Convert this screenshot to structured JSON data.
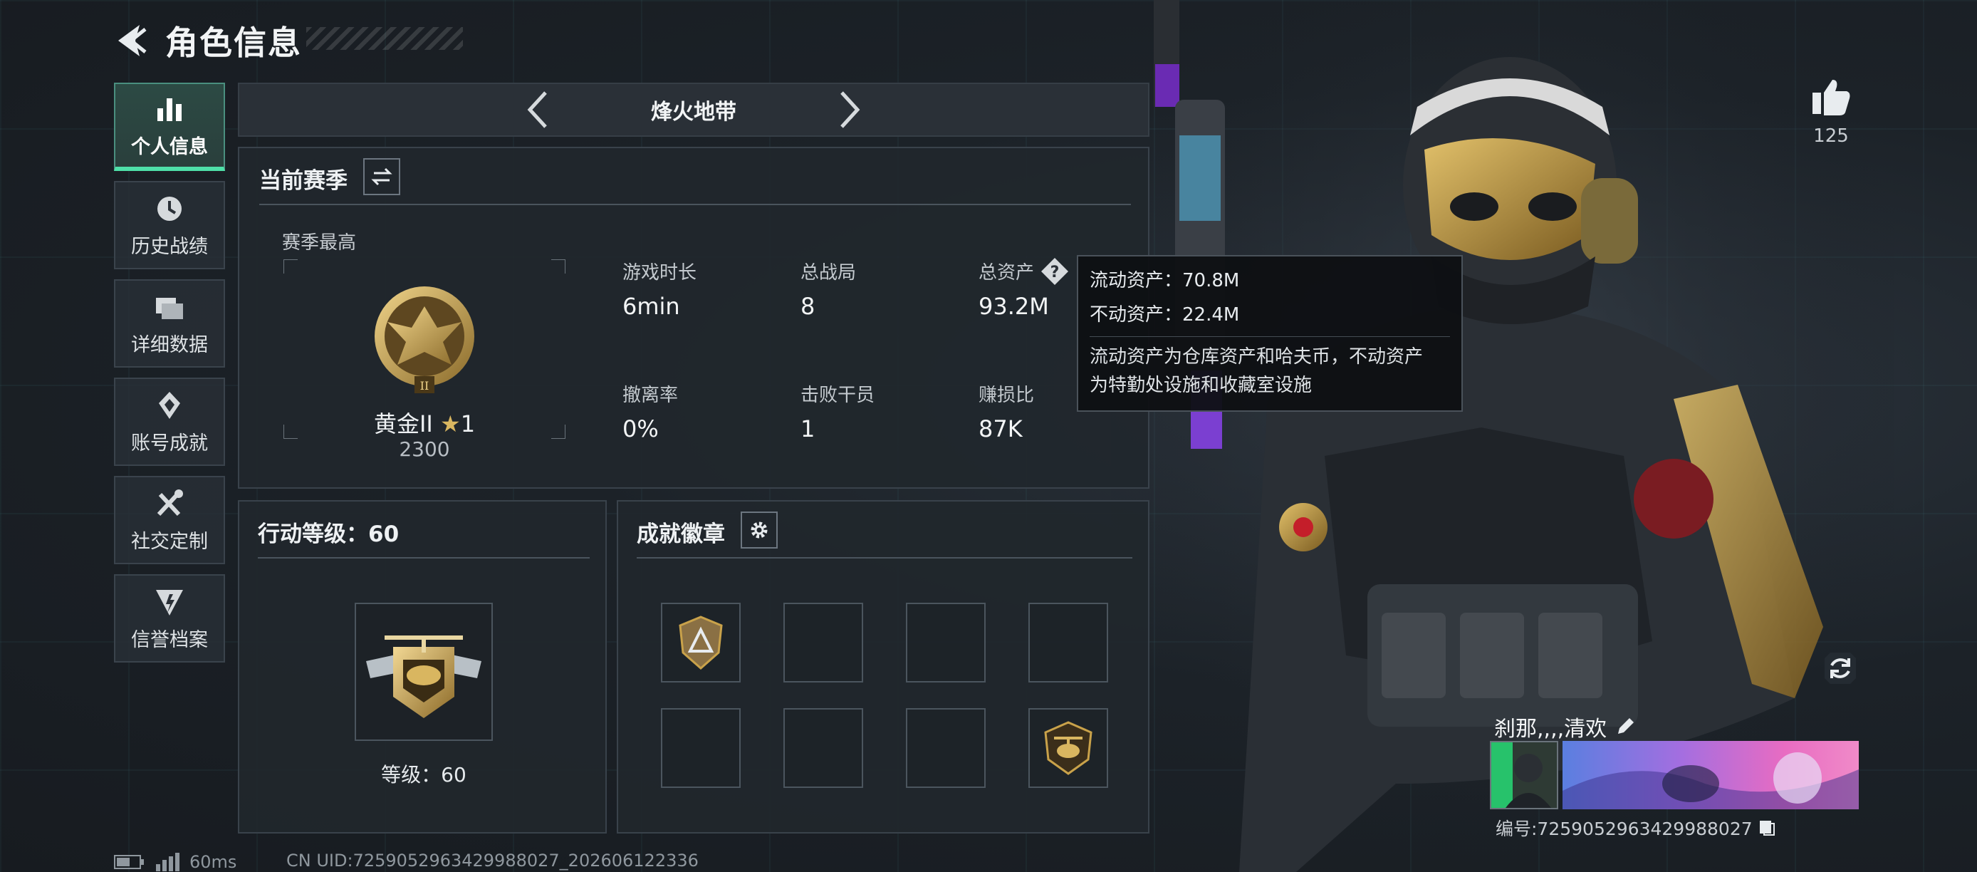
{
  "header": {
    "title": "角色信息"
  },
  "sidebar": {
    "items": [
      {
        "label": "个人信息",
        "icon": "bar-chart-icon",
        "active": true
      },
      {
        "label": "历史战绩",
        "icon": "history-icon",
        "active": false
      },
      {
        "label": "详细数据",
        "icon": "folder-icon",
        "active": false
      },
      {
        "label": "账号成就",
        "icon": "achievement-icon",
        "active": false
      },
      {
        "label": "社交定制",
        "icon": "tools-icon",
        "active": false
      },
      {
        "label": "信誉档案",
        "icon": "credit-icon",
        "active": false
      }
    ]
  },
  "mode_bar": {
    "name": "烽火地带"
  },
  "season": {
    "title": "当前赛季",
    "best_label": "赛季最高",
    "rank_name": "黄金II",
    "rank_stars": "1",
    "rank_score": "2300",
    "stats": [
      {
        "label": "游戏时长",
        "value": "6min"
      },
      {
        "label": "总战局",
        "value": "8"
      },
      {
        "label": "总资产",
        "value": "93.2M"
      },
      {
        "label": "撤离率",
        "value": "0%"
      },
      {
        "label": "击败干员",
        "value": "1"
      },
      {
        "label": "赚损比",
        "value": "87K"
      }
    ]
  },
  "tooltip": {
    "liquid": "流动资产：70.8M",
    "fixed": "不动资产：22.4M",
    "note_line1": "流动资产为仓库资产和哈夫币，不动资产",
    "note_line2": "为特勤处设施和收藏室设施"
  },
  "level": {
    "title": "行动等级：60",
    "label": "等级：60"
  },
  "badges": {
    "title": "成就徽章"
  },
  "profile": {
    "likes": "125",
    "name": "刹那,,,,清欢",
    "id_text": "编号:7259052963429988027"
  },
  "footer": {
    "ping": "60ms",
    "uid": "CN UID:7259052963429988027_202606122336"
  },
  "colors": {
    "accent": "#4fe0a8",
    "panel": "#21272d",
    "gold": "#c9a24a"
  }
}
